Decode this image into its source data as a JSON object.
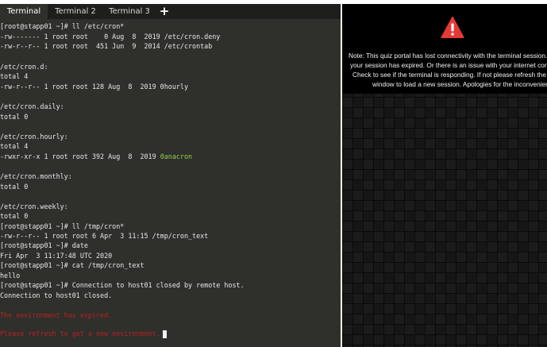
{
  "tabs": [
    {
      "label": "Terminal",
      "active": true
    },
    {
      "label": "Terminal 2",
      "active": false
    },
    {
      "label": "Terminal 3",
      "active": false
    }
  ],
  "add_tab_icon": "plus-icon",
  "terminal": {
    "lines": [
      "[root@stapp01 ~]# ll /etc/cron*",
      "-rw------- 1 root root    0 Aug  8  2019 /etc/cron.deny",
      "-rw-r--r-- 1 root root  451 Jun  9  2014 /etc/crontab",
      "",
      "/etc/cron.d:",
      "total 4",
      "-rw-r--r-- 1 root root 128 Aug  8  2019 0hourly",
      "",
      "/etc/cron.daily:",
      "total 0",
      "",
      "/etc/cron.hourly:",
      "total 4",
      "-rwxr-xr-x 1 root root 392 Aug  8  2019 ",
      "",
      "/etc/cron.monthly:",
      "total 0",
      "",
      "/etc/cron.weekly:",
      "total 0",
      "[root@stapp01 ~]# ll /tmp/cron*",
      "-rw-r--r-- 1 root root 6 Apr  3 11:15 /tmp/cron_text",
      "[root@stapp01 ~]# date",
      "Fri Apr  3 11:17:48 UTC 2020",
      "[root@stapp01 ~]# cat /tmp/cron_text",
      "hello",
      "[root@stapp01 ~]# Connection to host01 closed by remote host.",
      "Connection to host01 closed."
    ],
    "executable_name": "0anacron",
    "red_lines": [
      "The environment has expired.",
      "Please refresh to get a new environment."
    ]
  },
  "notice": {
    "icon": "warning-icon",
    "icon_color": "#e53935",
    "lines": [
      "Note: This quiz portal has lost connectivity with the terminal session. Eit",
      "your session has expired. Or there is an issue with your internet connecti",
      "Check to see if the terminal is responding. If not please refresh the term",
      "window to load a new session. Apologies for the inconvenience cause"
    ]
  },
  "colors": {
    "terminal_bg": "#2f2f2c",
    "terminal_text": "#e8e8e8",
    "executable_green": "#8fd04a",
    "error_red": "#b52222",
    "notice_bg": "#000000"
  }
}
